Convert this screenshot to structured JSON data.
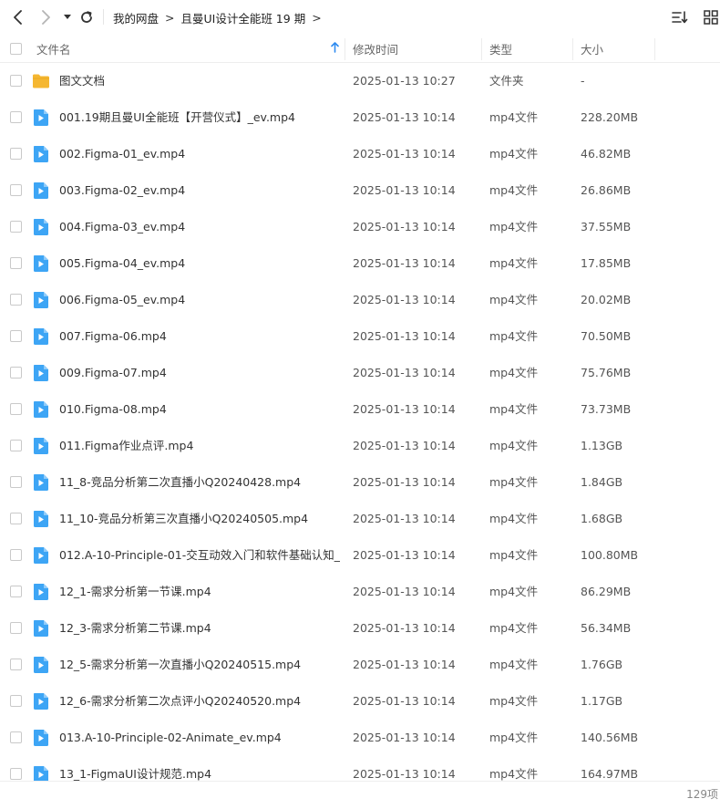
{
  "breadcrumb": {
    "items": [
      "我的网盘",
      "且曼UI设计全能班 19 期"
    ],
    "separator": ">"
  },
  "header": {
    "name_label": "文件名",
    "time_label": "修改时间",
    "type_label": "类型",
    "size_label": "大小"
  },
  "icons": {
    "back": "chevron-left-icon",
    "forward": "chevron-right-icon",
    "history": "caret-down-icon",
    "refresh": "refresh-icon",
    "sort": "sort-list-icon",
    "view": "grid-view-icon",
    "folder": "folder-icon",
    "video": "video-file-icon"
  },
  "colors": {
    "folder": "#F5B731",
    "video": "#3DA5F5",
    "sort_arrow": "#2F8CF0"
  },
  "files": [
    {
      "kind": "folder",
      "name": "图文文档",
      "time": "2025-01-13 10:27",
      "type": "文件夹",
      "size": "-"
    },
    {
      "kind": "video",
      "name": "001.19期且曼UI全能班【开营仪式】_ev.mp4",
      "time": "2025-01-13 10:14",
      "type": "mp4文件",
      "size": "228.20MB"
    },
    {
      "kind": "video",
      "name": "002.Figma-01_ev.mp4",
      "time": "2025-01-13 10:14",
      "type": "mp4文件",
      "size": "46.82MB"
    },
    {
      "kind": "video",
      "name": "003.Figma-02_ev.mp4",
      "time": "2025-01-13 10:14",
      "type": "mp4文件",
      "size": "26.86MB"
    },
    {
      "kind": "video",
      "name": "004.Figma-03_ev.mp4",
      "time": "2025-01-13 10:14",
      "type": "mp4文件",
      "size": "37.55MB"
    },
    {
      "kind": "video",
      "name": "005.Figma-04_ev.mp4",
      "time": "2025-01-13 10:14",
      "type": "mp4文件",
      "size": "17.85MB"
    },
    {
      "kind": "video",
      "name": "006.Figma-05_ev.mp4",
      "time": "2025-01-13 10:14",
      "type": "mp4文件",
      "size": "20.02MB"
    },
    {
      "kind": "video",
      "name": "007.Figma-06.mp4",
      "time": "2025-01-13 10:14",
      "type": "mp4文件",
      "size": "70.50MB"
    },
    {
      "kind": "video",
      "name": "009.Figma-07.mp4",
      "time": "2025-01-13 10:14",
      "type": "mp4文件",
      "size": "75.76MB"
    },
    {
      "kind": "video",
      "name": "010.Figma-08.mp4",
      "time": "2025-01-13 10:14",
      "type": "mp4文件",
      "size": "73.73MB"
    },
    {
      "kind": "video",
      "name": "011.Figma作业点评.mp4",
      "time": "2025-01-13 10:14",
      "type": "mp4文件",
      "size": "1.13GB"
    },
    {
      "kind": "video",
      "name": "11_8-竞品分析第二次直播小Q20240428.mp4",
      "time": "2025-01-13 10:14",
      "type": "mp4文件",
      "size": "1.84GB"
    },
    {
      "kind": "video",
      "name": "11_10-竞品分析第三次直播小Q20240505.mp4",
      "time": "2025-01-13 10:14",
      "type": "mp4文件",
      "size": "1.68GB"
    },
    {
      "kind": "video",
      "name": "012.A-10-Principle-01-交互动效入门和软件基础认知_...",
      "time": "2025-01-13 10:14",
      "type": "mp4文件",
      "size": "100.80MB"
    },
    {
      "kind": "video",
      "name": "12_1-需求分析第一节课.mp4",
      "time": "2025-01-13 10:14",
      "type": "mp4文件",
      "size": "86.29MB"
    },
    {
      "kind": "video",
      "name": "12_3-需求分析第二节课.mp4",
      "time": "2025-01-13 10:14",
      "type": "mp4文件",
      "size": "56.34MB"
    },
    {
      "kind": "video",
      "name": "12_5-需求分析第一次直播小Q20240515.mp4",
      "time": "2025-01-13 10:14",
      "type": "mp4文件",
      "size": "1.76GB"
    },
    {
      "kind": "video",
      "name": "12_6-需求分析第二次点评小Q20240520.mp4",
      "time": "2025-01-13 10:14",
      "type": "mp4文件",
      "size": "1.17GB"
    },
    {
      "kind": "video",
      "name": "013.A-10-Principle-02-Animate_ev.mp4",
      "time": "2025-01-13 10:14",
      "type": "mp4文件",
      "size": "140.56MB"
    },
    {
      "kind": "video",
      "name": "13_1-FigmaUI设计规范.mp4",
      "time": "2025-01-13 10:14",
      "type": "mp4文件",
      "size": "164.97MB"
    }
  ],
  "footer": {
    "count": "129项"
  }
}
